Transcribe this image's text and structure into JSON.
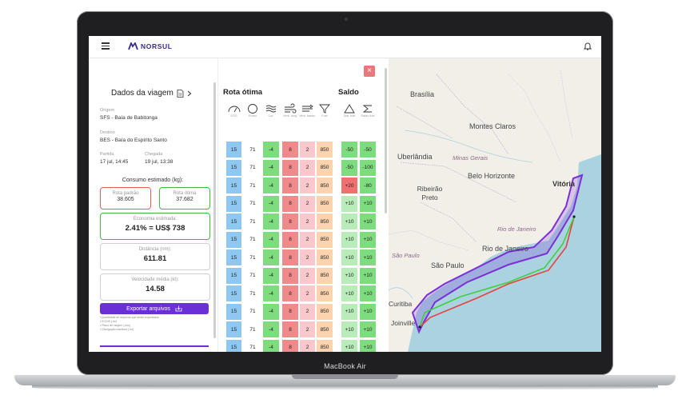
{
  "device": {
    "label": "MacBook Air"
  },
  "app": {
    "brand": "NORSUL"
  },
  "voyage": {
    "title": "Dados da viagem",
    "origin_label": "Origem",
    "origin_value": "SFS - Baía de Babitonga",
    "destination_label": "Destino",
    "destination_value": "BES - Baía do Espírito Santo",
    "departure_label": "Partida",
    "departure_value": "17 jul, 14:45",
    "arrival_label": "Chegada",
    "arrival_value": "19 jul, 13:38",
    "consumption_title": "Consumo estimado (kg):",
    "standard_route_label": "Rota padrão",
    "standard_route_value": "38.605",
    "optimal_route_label": "Rota ótima",
    "optimal_route_value": "37.682",
    "economy_label": "Economia estimada:",
    "economy_value": "2.41% = US$ 738",
    "distance_label": "Distância (nm):",
    "distance_value": "611.81",
    "avg_speed_label": "Velocidade média (kt):",
    "avg_speed_value": "14.58",
    "export_label": "Exportar arquivos",
    "notes": [
      "*Quantidade de arquivos que serão exportados:",
      "• ECDIS (.rtz)",
      "• Plano de viagem (.doc)",
      "• Divulgação marítima (.txt)"
    ]
  },
  "route_table": {
    "title": "Rota ótima",
    "balance_title": "Saldo",
    "columns": [
      {
        "label": "SOG",
        "icon": "gauge-icon"
      },
      {
        "label": "Rumo",
        "icon": "compass-icon"
      },
      {
        "label": "Cor.",
        "icon": "wave-icon"
      },
      {
        "label": "Vent. long.",
        "icon": "wind-icon"
      },
      {
        "label": "Vent. transv.",
        "icon": "crosswind-icon"
      },
      {
        "label": "Fuel",
        "icon": "funnel-icon"
      },
      {
        "label": "Dist. fuel",
        "icon": "delta-icon"
      },
      {
        "label": "Saldo fuel",
        "icon": "sigma-icon"
      }
    ],
    "rows": [
      [
        "15",
        "71",
        "-4",
        "8",
        "2",
        "850",
        "-50",
        "-50"
      ],
      [
        "15",
        "71",
        "-4",
        "8",
        "2",
        "850",
        "-50",
        "-100"
      ],
      [
        "15",
        "71",
        "-4",
        "8",
        "2",
        "850",
        "+20",
        "-80"
      ],
      [
        "15",
        "71",
        "-4",
        "8",
        "2",
        "850",
        "+10",
        "+10"
      ],
      [
        "15",
        "71",
        "-4",
        "8",
        "2",
        "850",
        "+10",
        "+10"
      ],
      [
        "15",
        "71",
        "-4",
        "8",
        "2",
        "850",
        "+10",
        "+10"
      ],
      [
        "15",
        "71",
        "-4",
        "8",
        "2",
        "850",
        "+10",
        "+10"
      ],
      [
        "15",
        "71",
        "-4",
        "8",
        "2",
        "850",
        "+10",
        "+10"
      ],
      [
        "15",
        "71",
        "-4",
        "8",
        "2",
        "850",
        "+10",
        "+10"
      ],
      [
        "15",
        "71",
        "-4",
        "8",
        "2",
        "850",
        "+10",
        "+10"
      ],
      [
        "15",
        "71",
        "-4",
        "8",
        "2",
        "850",
        "+10",
        "+10"
      ],
      [
        "15",
        "71",
        "-4",
        "8",
        "2",
        "850",
        "+10",
        "+10"
      ]
    ],
    "colors": {
      "sog": "#8ec8f0",
      "rumo": "#ffffff",
      "cor": "#7ddc7d",
      "vent_long": "#f08a8a",
      "vent_transv": "#f8c8cc",
      "fuel": "#fbd3ae",
      "neg": "#7ddc7d",
      "pos_red": "#f07070",
      "pos_green_light": "#b8ecb8",
      "pos_green": "#7ddc7d"
    }
  },
  "map": {
    "labels": [
      "Brasília",
      "Montes Claros",
      "Minas Gerais",
      "Uberlândia",
      "Belo Horizonte",
      "Vitória",
      "Ribeirão Preto",
      "Rio de Janeiro",
      "Rio de Janeiro",
      "São Paulo",
      "São Paulo",
      "Curitiba",
      "Joinville"
    ],
    "colors": {
      "route_optimal": "#3fcf3f",
      "route_standard": "#e84040",
      "corridor": "#7a2fd8",
      "sea": "#aad3df",
      "land": "#f2efe9"
    }
  }
}
